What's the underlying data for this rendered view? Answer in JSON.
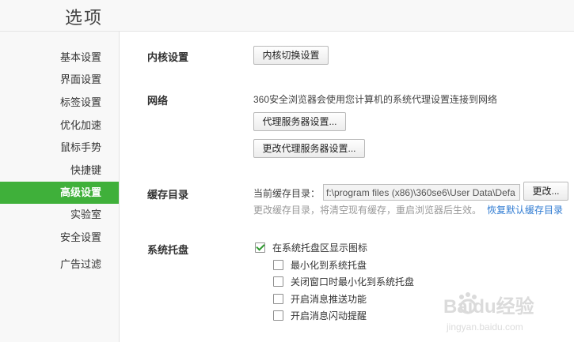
{
  "header": {
    "title": "选项"
  },
  "sidebar": {
    "items": [
      {
        "label": "基本设置"
      },
      {
        "label": "界面设置"
      },
      {
        "label": "标签设置"
      },
      {
        "label": "优化加速"
      },
      {
        "label": "鼠标手势"
      },
      {
        "label": "快捷键"
      },
      {
        "label": "高级设置",
        "active": true
      },
      {
        "label": "实验室"
      },
      {
        "label": "安全设置"
      },
      {
        "label": "广告过滤"
      }
    ]
  },
  "kernel": {
    "label": "内核设置",
    "button": "内核切换设置"
  },
  "network": {
    "label": "网络",
    "description": "360安全浏览器会使用您计算机的系统代理设置连接到网络",
    "proxy_button": "代理服务器设置...",
    "change_proxy_button": "更改代理服务器设置..."
  },
  "cache": {
    "label": "缓存目录",
    "current_label": "当前缓存目录：",
    "path_value": "f:\\program files (x86)\\360se6\\User Data\\Defa",
    "change_button": "更改...",
    "hint": "更改缓存目录，将清空现有缓存，重启浏览器后生效。",
    "restore_link": "恢复默认缓存目录"
  },
  "tray": {
    "label": "系统托盘",
    "options": [
      {
        "label": "在系统托盘区显示图标",
        "checked": true
      },
      {
        "label": "最小化到系统托盘",
        "checked": false
      },
      {
        "label": "关闭窗口时最小化到系统托盘",
        "checked": false
      },
      {
        "label": "开启消息推送功能",
        "checked": false
      },
      {
        "label": "开启消息闪动提醒",
        "checked": false
      }
    ]
  },
  "watermark": {
    "text": "Baidu经验",
    "sub": "jingyan.baidu.com"
  }
}
